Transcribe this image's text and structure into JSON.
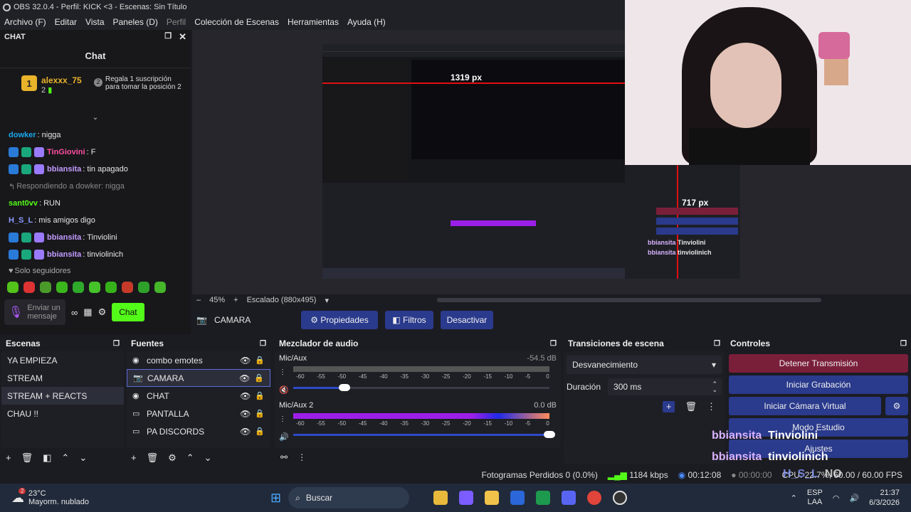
{
  "window": {
    "title": "OBS 32.0.4 - Perfil: KICK <3 - Escenas: Sin Título"
  },
  "menu": [
    {
      "label": "Archivo (F)",
      "enabled": true
    },
    {
      "label": "Editar",
      "enabled": true
    },
    {
      "label": "Vista",
      "enabled": true
    },
    {
      "label": "Paneles (D)",
      "enabled": true
    },
    {
      "label": "Perfil",
      "enabled": false
    },
    {
      "label": "Colección de Escenas",
      "enabled": true
    },
    {
      "label": "Herramientas",
      "enabled": true
    },
    {
      "label": "Ayuda (H)",
      "enabled": true
    }
  ],
  "chat": {
    "dock_label": "CHAT",
    "title": "Chat",
    "pinned": {
      "rank": "1",
      "user": "alexxx_75",
      "count": "2",
      "gift_rank": "2",
      "gift_text": "Regala 1 suscripción para tomar la posición 2"
    },
    "messages": [
      {
        "user": "dowker",
        "color": "#1aa7ec",
        "text": ": nigga"
      },
      {
        "user": "TinGiovini",
        "color": "#ff4fa0",
        "text": ": F"
      },
      {
        "user": "bbiansita",
        "color": "#c29bff",
        "text": ": tin apagado"
      },
      {
        "reply": "Respondiendo a dowker: nigga"
      },
      {
        "user": "sant0vv",
        "color": "#53fc18",
        "text": ": RUN"
      },
      {
        "user": "H_S_L",
        "color": "#8a9cff",
        "text": ": mis amigos digo"
      },
      {
        "user": "bbiansita",
        "color": "#c29bff",
        "text": ": Tinviolini"
      },
      {
        "user": "bbiansita",
        "color": "#c29bff",
        "text": ": tinviolinich"
      },
      {
        "user": "H_S_L",
        "color": "#8a9cff",
        "text": ": NO"
      }
    ],
    "followers_only": "Solo seguidores",
    "input_placeholder": "Enviar un mensaje",
    "send_label": "Chat"
  },
  "preview": {
    "zoom": "45%",
    "scale": "Escalado (880x495)",
    "nested": {
      "width_label": "1319 px",
      "height_label": "717 px",
      "chat_overlay": [
        {
          "user": "bbiansita",
          "text": "Tinviolini"
        },
        {
          "user": "bbiansita",
          "text": "tinviolinich"
        }
      ]
    }
  },
  "source_bar": {
    "source": "CAMARA",
    "properties": "Propiedades",
    "filters": "Filtros",
    "deactivate": "Desactivar"
  },
  "scenes": {
    "title": "Escenas",
    "items": [
      "YA EMPIEZA",
      "STREAM",
      "STREAM + REACTS",
      "CHAU !!"
    ],
    "selected": 2
  },
  "sources": {
    "title": "Fuentes",
    "items": [
      {
        "name": "combo emotes",
        "icon": "browser-icon"
      },
      {
        "name": "CAMARA",
        "icon": "camera-icon"
      },
      {
        "name": "CHAT",
        "icon": "browser-icon"
      },
      {
        "name": "PANTALLA",
        "icon": "monitor-icon"
      },
      {
        "name": "PA DISCORDS",
        "icon": "window-icon"
      }
    ],
    "selected": 1
  },
  "mixer": {
    "title": "Mezclador de audio",
    "ticks": [
      "-60",
      "-55",
      "-50",
      "-45",
      "-40",
      "-35",
      "-30",
      "-25",
      "-20",
      "-15",
      "-10",
      "-5",
      "0"
    ],
    "channels": [
      {
        "name": "Mic/Aux",
        "db": "-54.5 dB",
        "muted": true,
        "level": 0.0,
        "volume": 0.2
      },
      {
        "name": "Mic/Aux 2",
        "db": "0.0 dB",
        "muted": false,
        "level": 1.0,
        "volume": 1.0
      }
    ]
  },
  "transitions": {
    "title": "Transiciones de escena",
    "selected": "Desvanecimiento",
    "duration_label": "Duración",
    "duration": "300 ms"
  },
  "controls": {
    "title": "Controles",
    "stop_stream": "Detener Transmisión",
    "start_record": "Iniciar Grabación",
    "virtual_cam": "Iniciar Cámara Virtual",
    "studio_mode": "Modo Estudio",
    "settings": "Ajustes"
  },
  "overlay_chat": [
    {
      "user": "bbiansita",
      "text": "Tinviolini"
    },
    {
      "user": "bbiansita",
      "text": "tinviolinich"
    },
    {
      "user": "H_S_L",
      "text": "NO"
    }
  ],
  "status": {
    "dropped": "Fotogramas Perdidos 0 (0.0%)",
    "kbps": "1184 kbps",
    "stream_time": "00:12:08",
    "rec_time": "00:00:00",
    "cpu": "CPU: 22.7%, 60.00 / 60.00 FPS"
  },
  "taskbar": {
    "weather_temp": "23°C",
    "weather_desc": "Mayorm. nublado",
    "weather_badge": "2",
    "search": "Buscar",
    "lang": "ESP",
    "lang2": "LAA",
    "time": "21:37",
    "date": "6/3/2026"
  },
  "colors": {
    "accent_green": "#53fc18",
    "obs_blue": "#2a3a8c",
    "stop_red": "#7a1f3a",
    "meter_purple": "#9b1fe8"
  }
}
